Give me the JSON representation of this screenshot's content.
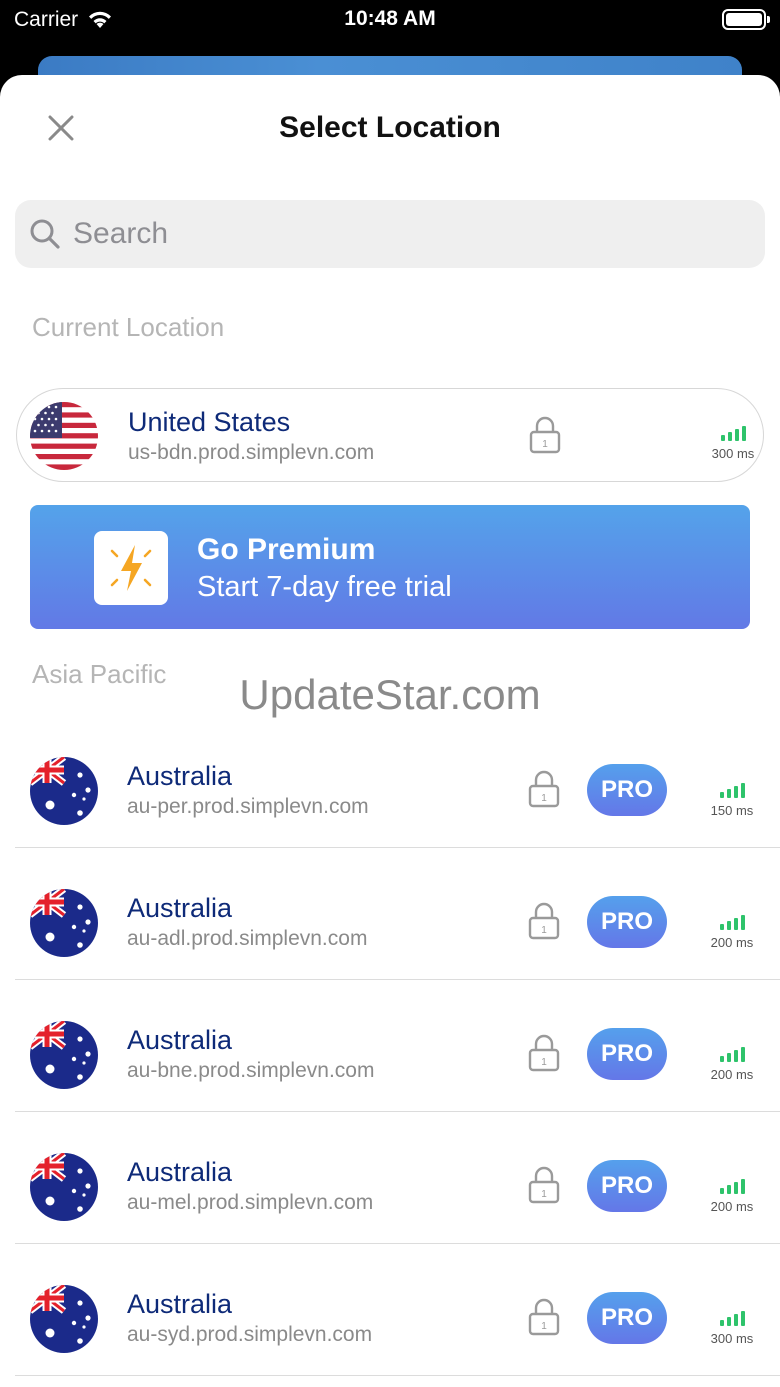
{
  "status_bar": {
    "carrier": "Carrier",
    "time": "10:48 AM"
  },
  "header": {
    "title": "Select Location",
    "close_icon": "close-icon"
  },
  "search": {
    "placeholder": "Search"
  },
  "current_section": {
    "label": "Current Location"
  },
  "current_location": {
    "name": "United States",
    "host": "us-bdn.prod.simplevn.com",
    "latency": "300 ms",
    "signal_level": 3
  },
  "premium_banner": {
    "title": "Go Premium",
    "subtitle": "Start 7-day free trial"
  },
  "asia_section": {
    "label": "Asia Pacific"
  },
  "watermark": "UpdateStar.com",
  "pro_label": "PRO",
  "colors": {
    "accent": "#5a8fe9",
    "signal": "#2ec36b",
    "name": "#0e2a78"
  },
  "servers": [
    {
      "name": "Australia",
      "host": "au-per.prod.simplevn.com",
      "latency": "150 ms",
      "signal_level": 3
    },
    {
      "name": "Australia",
      "host": "au-adl.prod.simplevn.com",
      "latency": "200 ms",
      "signal_level": 3
    },
    {
      "name": "Australia",
      "host": "au-bne.prod.simplevn.com",
      "latency": "200 ms",
      "signal_level": 3
    },
    {
      "name": "Australia",
      "host": "au-mel.prod.simplevn.com",
      "latency": "200 ms",
      "signal_level": 3
    },
    {
      "name": "Australia",
      "host": "au-syd.prod.simplevn.com",
      "latency": "300 ms",
      "signal_level": 3
    }
  ]
}
